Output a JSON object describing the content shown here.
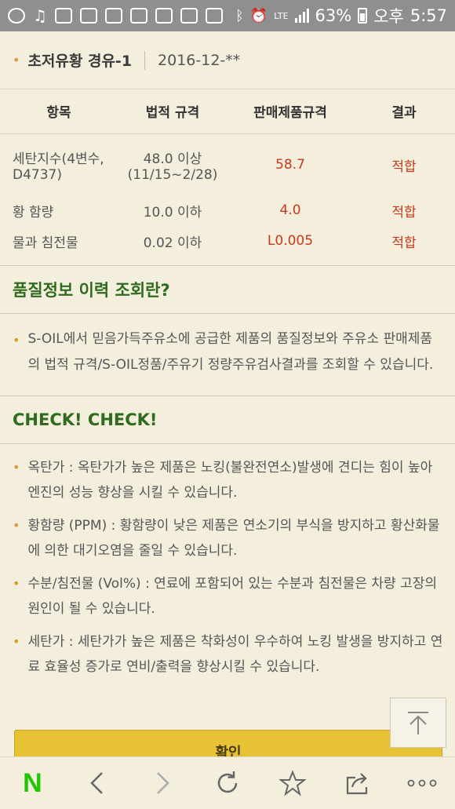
{
  "status_bar": {
    "icons": [
      "refresh-icon",
      "music-icon",
      "shield-icon",
      "flipboard-icon",
      "blog-icon",
      "mail-icon",
      "image-icon",
      "file-icon",
      "check-icon",
      "bluetooth-icon",
      "alarm-icon",
      "lte-icon",
      "signal-icon"
    ],
    "lte": "LTE",
    "battery_pct": "63%",
    "am_pm": "오후",
    "time": "5:57"
  },
  "header": {
    "title": "초저유황 경유-1",
    "date": "2016-12-**"
  },
  "table": {
    "columns": [
      "항목",
      "법적 규격",
      "판매제품규격",
      "결과"
    ],
    "rows": [
      {
        "item_line1": "세탄지수(4변수,",
        "item_line2": "D4737)",
        "legal_line1": "48.0 이상",
        "legal_line2": "(11/15~2/28)",
        "product": "58.7",
        "result": "적합"
      },
      {
        "item_line1": "황 함량",
        "legal_line1": "10.0 이하",
        "product": "4.0",
        "result": "적합"
      },
      {
        "item_line1": "물과 침전물",
        "legal_line1": "0.02 이하",
        "product": "L0.005",
        "result": "적합"
      }
    ]
  },
  "quality_section": {
    "title": "품질정보 이력 조회란?",
    "text": "S-OIL에서 믿음가득주유소에 공급한 제품의 품질정보와 주유소 판매제품의 법적 규격/S-OIL정품/주유기 정량주유검사결과를 조회할 수 있습니다."
  },
  "check_section": {
    "title": "CHECK! CHECK!",
    "items": [
      "옥탄가 : 옥탄가가 높은 제품은 노킹(불완전연소)발생에 견디는 힘이 높아 엔진의 성능 향상을 시킬 수 있습니다.",
      "황함량 (PPM) : 황함량이 낮은 제품은 연소기의 부식을 방지하고 황산화물에 의한 대기오염을 줄일 수 있습니다.",
      "수분/침전물 (Vol%) : 연료에 포함되어 있는 수분과 침전물은 차량 고장의 원인이 될 수 있습니다.",
      "세탄가 : 세탄가가 높은 제품은 착화성이 우수하여 노킹 발생을 방지하고 연료 효율성 증가로 연비/출력을 향상시킬 수 있습니다."
    ]
  },
  "confirm_button": "확인",
  "nav": {
    "logo": "N"
  },
  "colors": {
    "accent_green": "#2e6b1e",
    "result_red": "#c8391b",
    "button_yellow": "#e7c234",
    "naver_green": "#1ec800"
  }
}
